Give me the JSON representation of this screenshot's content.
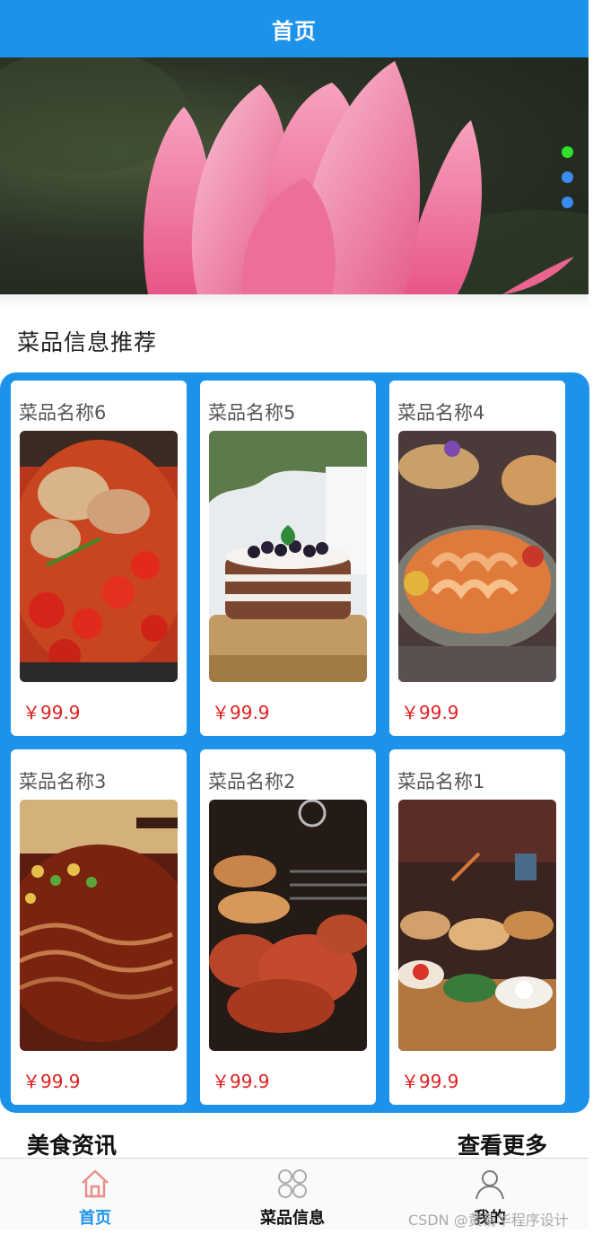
{
  "header": {
    "title": "首页"
  },
  "banner": {
    "slide_count": 3,
    "active_index": 0,
    "colors": {
      "active": "#2ce22b",
      "inactive": "#3b8cf0"
    }
  },
  "recommend": {
    "title": "菜品信息推荐",
    "items": [
      {
        "name": "菜品名称6",
        "price": "￥99.9",
        "image": "spicy-stew"
      },
      {
        "name": "菜品名称5",
        "price": "￥99.9",
        "image": "layer-cake"
      },
      {
        "name": "菜品名称4",
        "price": "￥99.9",
        "image": "seafood-platter"
      },
      {
        "name": "菜品名称3",
        "price": "￥99.9",
        "image": "noodle-soup"
      },
      {
        "name": "菜品名称2",
        "price": "￥99.9",
        "image": "grilled-meat"
      },
      {
        "name": "菜品名称1",
        "price": "￥99.9",
        "image": "banquet-spread"
      }
    ]
  },
  "news": {
    "title": "美食资讯",
    "more_label": "查看更多"
  },
  "tabbar": {
    "items": [
      {
        "label": "首页",
        "icon": "home-icon",
        "active": true
      },
      {
        "label": "菜品信息",
        "icon": "grid-icon",
        "active": false
      },
      {
        "label": "我的",
        "icon": "user-icon",
        "active": false
      }
    ]
  },
  "watermark": "CSDN @黄菊华程序设计",
  "colors": {
    "primary": "#1d92ea",
    "price": "#e02020"
  }
}
